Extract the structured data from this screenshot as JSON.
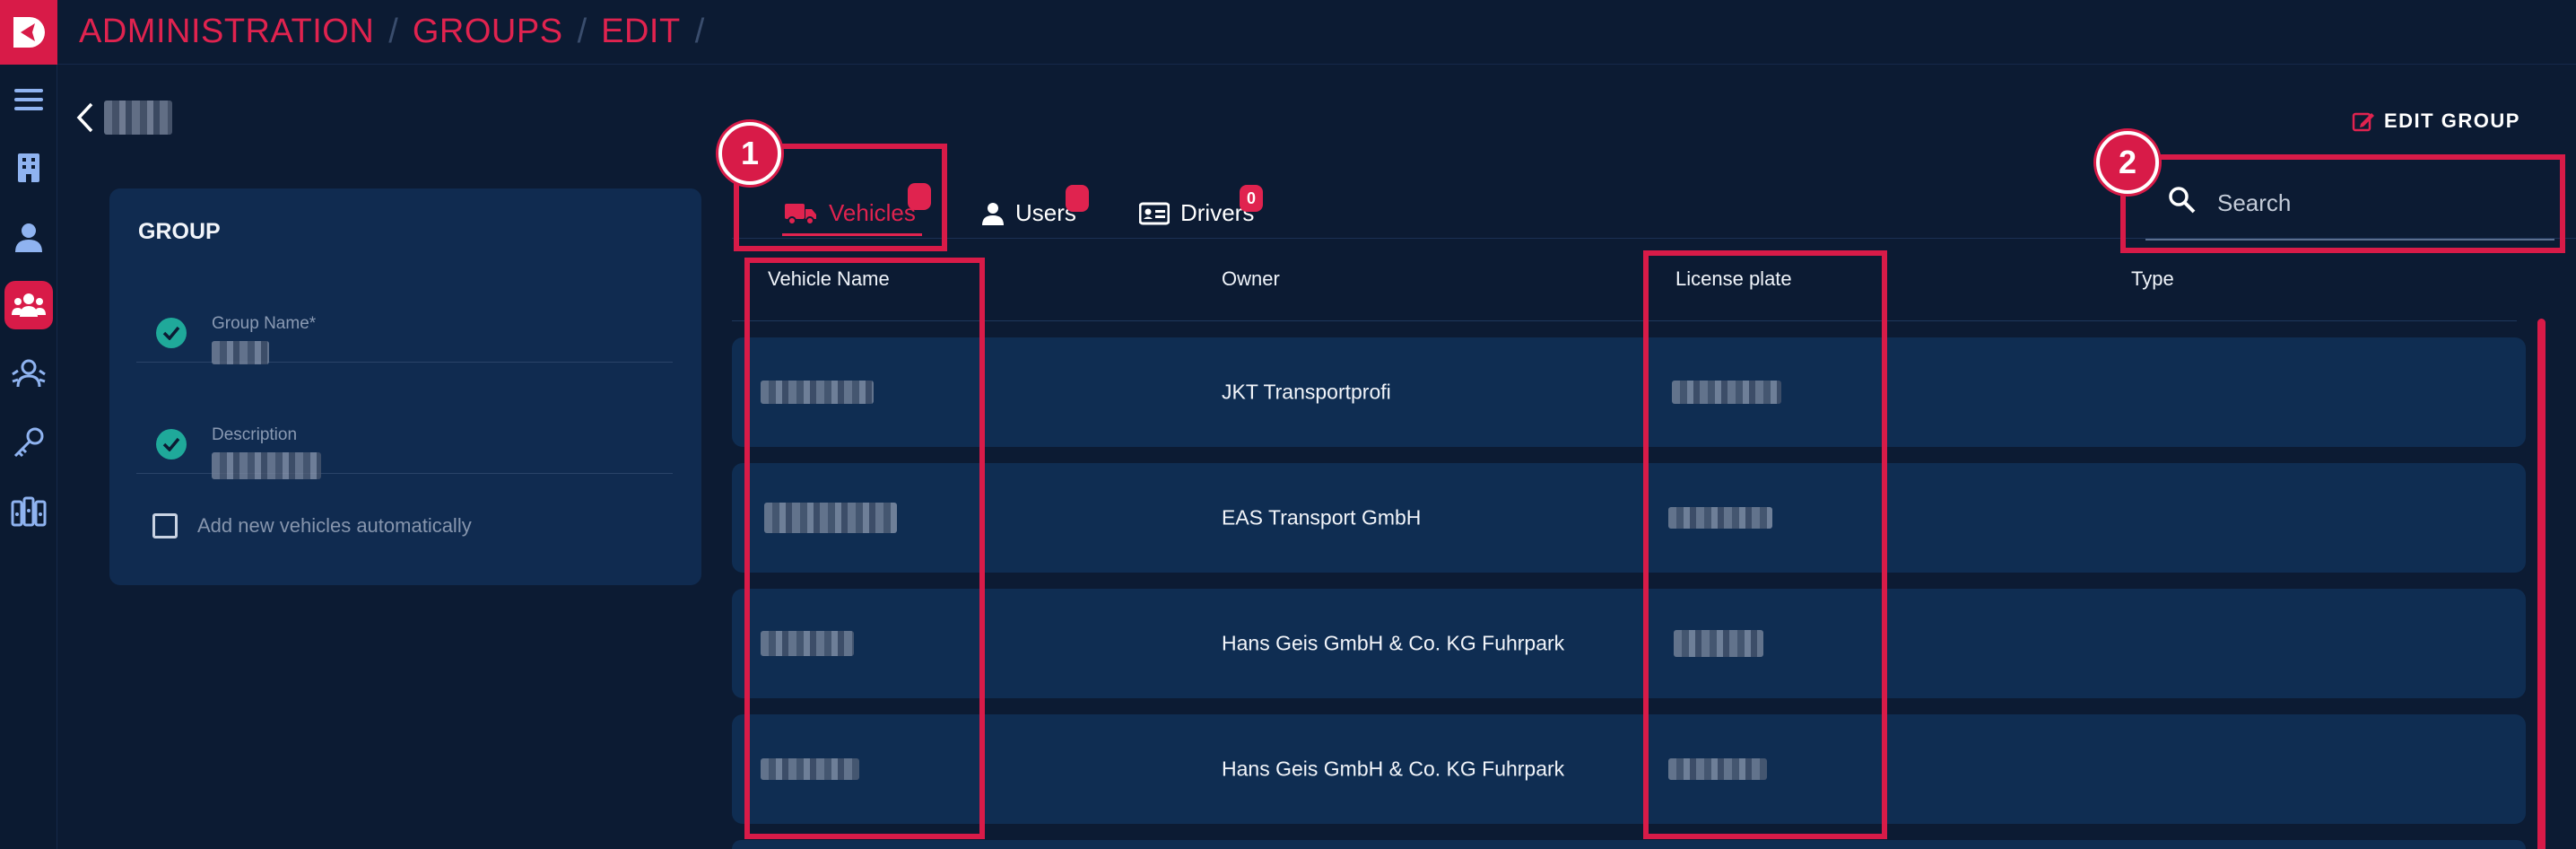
{
  "breadcrumb": [
    "ADMINISTRATION",
    "GROUPS",
    "EDIT"
  ],
  "header": {
    "edit_group_label": "EDIT GROUP"
  },
  "group_card": {
    "title": "GROUP",
    "group_name_label": "Group Name*",
    "description_label": "Description",
    "auto_add_label": "Add new vehicles automatically"
  },
  "tabs": [
    {
      "label": "Vehicles",
      "badge": "",
      "active": true
    },
    {
      "label": "Users",
      "badge": "",
      "active": false
    },
    {
      "label": "Drivers",
      "badge": "0",
      "active": false
    }
  ],
  "search": {
    "placeholder": "Search"
  },
  "table": {
    "columns": [
      "Vehicle Name",
      "Owner",
      "License plate",
      "Type"
    ],
    "rows": [
      {
        "owner": "JKT Transportprofi"
      },
      {
        "owner": "EAS Transport GmbH"
      },
      {
        "owner": "Hans Geis GmbH & Co. KG Fuhrpark"
      },
      {
        "owner": "Hans Geis GmbH & Co. KG Fuhrpark"
      }
    ]
  },
  "annotations": [
    "1",
    "2"
  ],
  "colors": {
    "accent": "#e0234f",
    "background": "#0c1b33",
    "card": "#102b50",
    "check": "#1fa99a"
  }
}
